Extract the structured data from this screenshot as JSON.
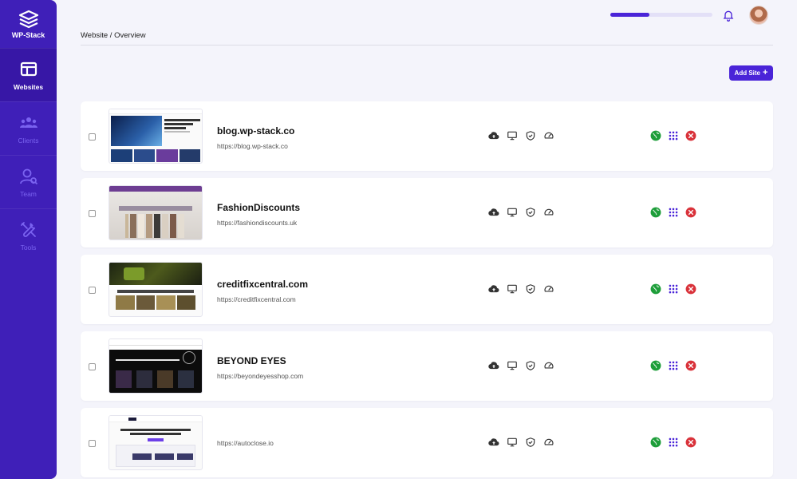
{
  "app": {
    "brand": "WP-Stack"
  },
  "sidebar": {
    "items": [
      {
        "label": "Websites",
        "icon": "websites-icon",
        "active": true
      },
      {
        "label": "Clients",
        "icon": "clients-icon",
        "active": false
      },
      {
        "label": "Team",
        "icon": "team-icon",
        "active": false
      },
      {
        "label": "Tools",
        "icon": "tools-icon",
        "active": false
      }
    ]
  },
  "header": {
    "progress_percent": 38,
    "breadcrumb": "Website / Overview"
  },
  "toolbar": {
    "add_site_label": "Add Site",
    "add_site_icon": "+"
  },
  "colors": {
    "accent": "#4a24d8",
    "sidebar": "#3f1fb8",
    "status_ok": "#1e9e3a",
    "status_error": "#d9323a"
  },
  "sites": [
    {
      "name": "blog.wp-stack.co",
      "url": "https://blog.wp-stack.co"
    },
    {
      "name": "FashionDiscounts",
      "url": "https://fashiondiscounts.uk"
    },
    {
      "name": "creditfixcentral.com",
      "url": "https://creditfixcentral.com"
    },
    {
      "name": "BEYOND EYES",
      "url": "https://beyondeyesshop.com"
    },
    {
      "name": "",
      "url": "https://autoclose.io"
    }
  ],
  "site_actions": [
    "cloud-upload-icon",
    "monitor-icon",
    "shield-check-icon",
    "speedometer-icon"
  ],
  "site_status": [
    "globe-icon",
    "apps-grid-icon",
    "error-icon"
  ]
}
